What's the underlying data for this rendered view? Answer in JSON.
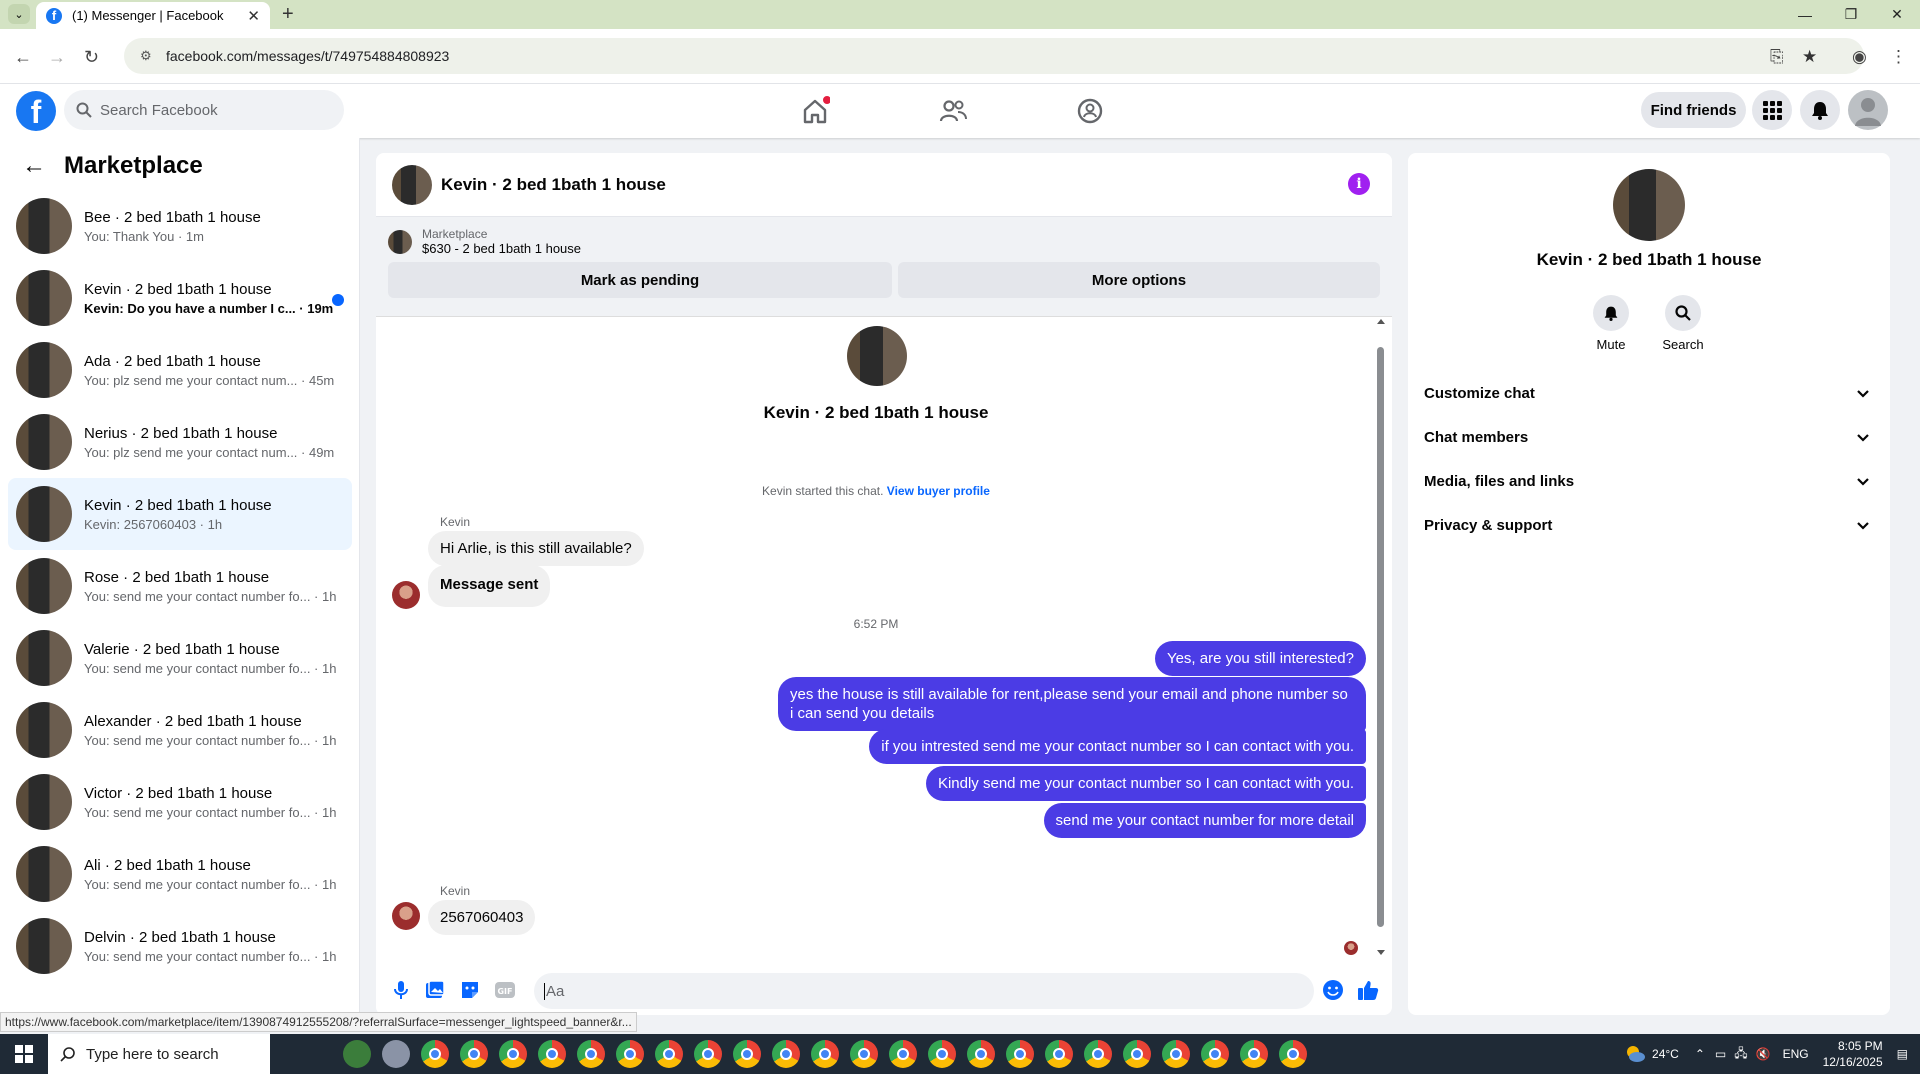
{
  "browser": {
    "tab_title": "(1) Messenger | Facebook",
    "url": "facebook.com/messages/t/749754884808923",
    "status_url": "https://www.facebook.com/marketplace/item/1390874912555208/?referralSurface=messenger_lightspeed_banner&r..."
  },
  "header": {
    "search_placeholder": "Search Facebook",
    "find_friends": "Find friends"
  },
  "left": {
    "title": "Marketplace",
    "conversations": [
      {
        "name": "Bee · 2 bed 1bath 1 house",
        "preview": "You: Thank You · 1m",
        "unread": false,
        "selected": false
      },
      {
        "name": "Kevin · 2 bed 1bath 1 house",
        "preview": "Kevin: Do you have a number I c... · 19m",
        "unread": true,
        "selected": false
      },
      {
        "name": "Ada · 2 bed 1bath 1 house",
        "preview": "You: plz send me your contact num... · 45m",
        "unread": false,
        "selected": false
      },
      {
        "name": "Nerius · 2 bed 1bath 1 house",
        "preview": "You: plz send me your contact num... · 49m",
        "unread": false,
        "selected": false
      },
      {
        "name": "Kevin · 2 bed 1bath 1 house",
        "preview": "Kevin: 2567060403 · 1h",
        "unread": false,
        "selected": true
      },
      {
        "name": "Rose · 2 bed 1bath 1 house",
        "preview": "You: send me your contact number fo... · 1h",
        "unread": false,
        "selected": false
      },
      {
        "name": "Valerie · 2 bed 1bath 1 house",
        "preview": "You: send me your contact number fo... · 1h",
        "unread": false,
        "selected": false
      },
      {
        "name": "Alexander · 2 bed 1bath 1 house",
        "preview": "You: send me your contact number fo... · 1h",
        "unread": false,
        "selected": false
      },
      {
        "name": "Victor · 2 bed 1bath 1 house",
        "preview": "You: send me your contact number fo... · 1h",
        "unread": false,
        "selected": false
      },
      {
        "name": "Ali · 2 bed 1bath 1 house",
        "preview": "You: send me your contact number fo... · 1h",
        "unread": false,
        "selected": false
      },
      {
        "name": "Delvin · 2 bed 1bath 1 house",
        "preview": "You: send me your contact number fo... · 1h",
        "unread": false,
        "selected": false
      }
    ]
  },
  "chat": {
    "title": "Kevin · 2 bed 1bath 1 house",
    "marketplace_label": "Marketplace",
    "listing": "$630 - 2 bed 1bath 1 house",
    "mark_pending": "Mark as pending",
    "more_options": "More options",
    "intro_name": "Kevin · 2 bed 1bath 1 house",
    "started_text": "Kevin started this chat.",
    "view_profile": "View buyer profile",
    "sender1": "Kevin",
    "in_msg1": "Hi Arlie, is this still available?",
    "in_msg2": "Message sent",
    "time": "6:52 PM",
    "out_msgs": [
      "Yes, are you still interested?",
      "yes the house is still available for rent,please send your email and phone number so i can send you details",
      "if you intrested send me your contact number so I can contact with you.",
      "Kindly send me your contact number so I can contact with you.",
      "send me your contact number for more detail"
    ],
    "sender2": "Kevin",
    "in_msg3": "2567060403",
    "input_placeholder": "Aa"
  },
  "right": {
    "name": "Kevin · 2 bed 1bath 1 house",
    "mute": "Mute",
    "search": "Search",
    "sections": [
      "Customize chat",
      "Chat members",
      "Media, files and links",
      "Privacy & support"
    ]
  },
  "taskbar": {
    "search_placeholder": "Type here to search",
    "temp": "24°C",
    "lang": "ENG",
    "time": "8:05 PM",
    "date": "12/16/2025"
  },
  "colors": {
    "accent": "#1877f2",
    "outgoing": "#4b3ce5",
    "info": "#a020f0"
  }
}
